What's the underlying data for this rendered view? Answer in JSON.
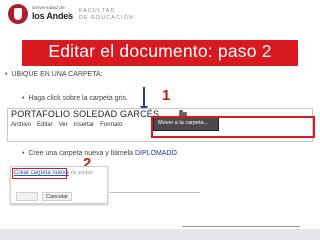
{
  "header": {
    "university_small": "Universidad de",
    "university_name": "los Andes",
    "faculty_line1": "FACULTAD",
    "faculty_line2": "DE EDUCACIÓN"
  },
  "slide": {
    "title": "Editar el documento: paso 2",
    "bullet1": "UBIQUE EN UNA CARPETA:",
    "bullet2": "Haga click sobre la carpeta gris.",
    "bullet3_prefix": "Cree una carpeta nueva y llámela ",
    "bullet3_highlight": "DIPLOMADO.",
    "marker1": "1",
    "marker2": "2"
  },
  "screenshot1": {
    "doc_title": "PORTAFOLIO SOLEDAD GARCÉS",
    "menu": [
      "Archivo",
      "Editar",
      "Ver",
      "Insertar",
      "Formato"
    ],
    "move_tooltip": "Mover a la carpeta..."
  },
  "screenshot2": {
    "create_folder_link": "Crear carpeta nueva",
    "unidad_text": "mi unidad",
    "cancel_label": "Cancelar"
  },
  "colors": {
    "accent_red": "#d8191f",
    "arrow_blue": "#1c3f9a",
    "link_blue": "#1a55c9"
  }
}
